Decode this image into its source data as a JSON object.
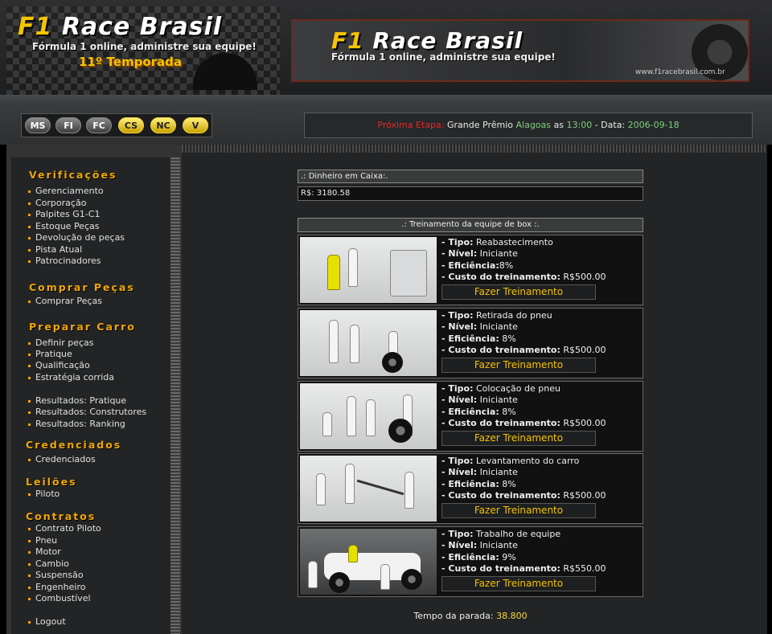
{
  "header": {
    "logo_f1": "F1",
    "logo_text": "Race Brasil",
    "tagline": "Fórmula 1 online, administre sua equipe!",
    "season": "11º Temporada",
    "banner_url": "www.f1racebrasil.com.br"
  },
  "nav_buttons": [
    {
      "label": "MS",
      "style": "gray"
    },
    {
      "label": "FI",
      "style": "gray"
    },
    {
      "label": "FC",
      "style": "gray"
    },
    {
      "label": "CS",
      "style": "gold"
    },
    {
      "label": "NC",
      "style": "gold"
    },
    {
      "label": "V",
      "style": "gold"
    }
  ],
  "next_stage": {
    "label": "Próxima Etapa:",
    "race_prefix": "Grande Prêmio",
    "race": "Alagoas",
    "at": "as",
    "time": "13:00",
    "date_label": "- Data:",
    "date": "2006-09-18"
  },
  "sidebar": {
    "sections": [
      {
        "title": "Verificações",
        "items": [
          "Gerenciamento",
          "Corporação",
          "Palpites G1-C1",
          "Estoque Peças",
          "Devolução de peças",
          "Pista Atual",
          "Patrocinadores"
        ]
      },
      {
        "title": "Comprar Peças",
        "items": [
          "Comprar Peças"
        ]
      },
      {
        "title": "Preparar Carro",
        "items": [
          "Definir peças",
          "Pratique",
          "Qualificação",
          "Estratégia corrida",
          "Resultados: Pratique",
          "Resultados: Construtores",
          "Resultados: Ranking"
        ]
      },
      {
        "title": "Credenciados",
        "items": [
          "Credenciados"
        ]
      },
      {
        "title": "Leilões",
        "items": [
          "Piloto"
        ]
      },
      {
        "title": "Contratos",
        "items": [
          "Contrato Piloto",
          "Pneu",
          "Motor",
          "Cambio",
          "Suspensão",
          "Engenheiro",
          "Combustível",
          "Logout"
        ]
      }
    ]
  },
  "cash": {
    "title": ".: Dinheiro em Caixa:.",
    "value": "R$: 3180.58"
  },
  "training": {
    "title": ".: Treinamento da equipe de box :.",
    "labels": {
      "tipo": "- Tipo:",
      "nivel": "- Nível:",
      "eficiencia": "- Eficiência:",
      "custo": "- Custo do treinamento:"
    },
    "button_label": "Fazer Treinamento",
    "cards": [
      {
        "tipo": "Reabastecimento",
        "nivel": "Iniciante",
        "eficiencia": "8%",
        "custo": "R$500.00"
      },
      {
        "tipo": "Retirada do pneu",
        "nivel": "Iniciante",
        "eficiencia": "8%",
        "custo": "R$500.00"
      },
      {
        "tipo": "Colocação de pneu",
        "nivel": "Iniciante",
        "eficiencia": "8%",
        "custo": "R$500.00"
      },
      {
        "tipo": "Levantamento do carro",
        "nivel": "Iniciante",
        "eficiencia": "8%",
        "custo": "R$500.00"
      },
      {
        "tipo": "Trabalho de equipe",
        "nivel": "Iniciante",
        "eficiencia": "9%",
        "custo": "R$550.00"
      }
    ]
  },
  "pit_time": {
    "label": "Tempo da parada:",
    "value": "38.800"
  }
}
